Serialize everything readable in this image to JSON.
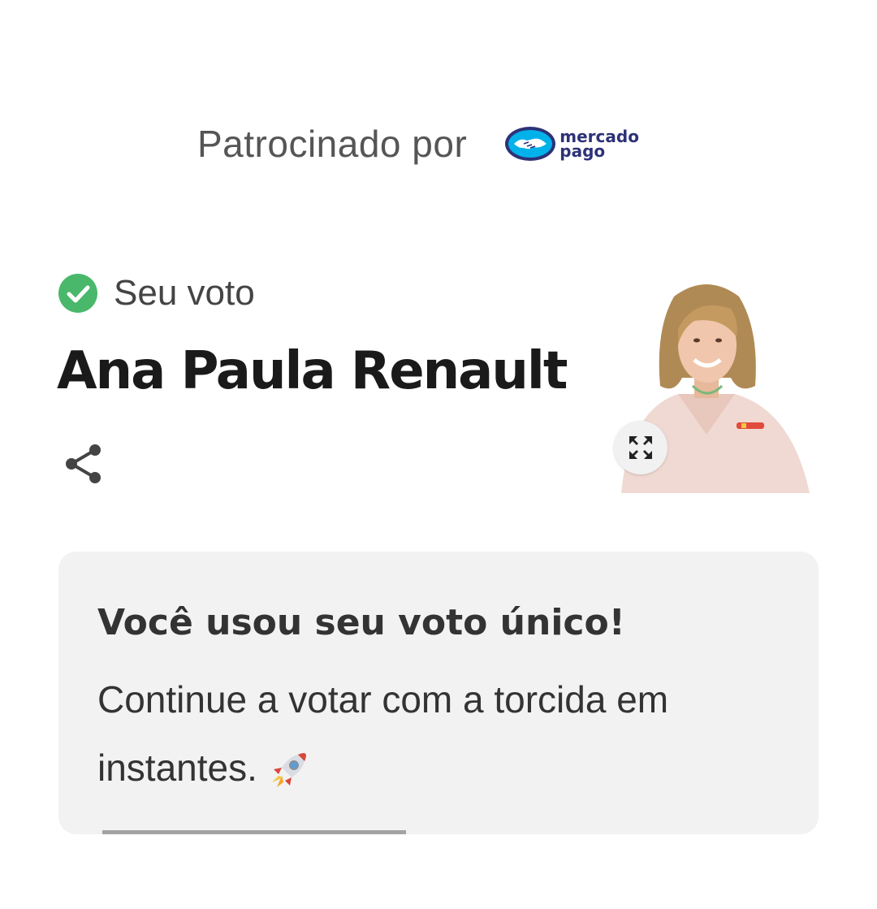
{
  "sponsor": {
    "label": "Patrocinado por",
    "brand_line1": "mercado",
    "brand_line2": "pago",
    "brand_color": "#2d3277",
    "brand_light_color": "#00b1ea"
  },
  "vote": {
    "label": "Seu voto",
    "check_color": "#4ab86b",
    "candidate_name": "Ana Paula Renault"
  },
  "icons": {
    "check": "check-circle-icon",
    "share": "share-icon",
    "expand": "expand-icon",
    "rocket": "rocket-icon"
  },
  "info": {
    "title": "Você usou seu voto único!",
    "body": "Continue a votar com a torcida em instantes.",
    "progress": 0.45
  }
}
